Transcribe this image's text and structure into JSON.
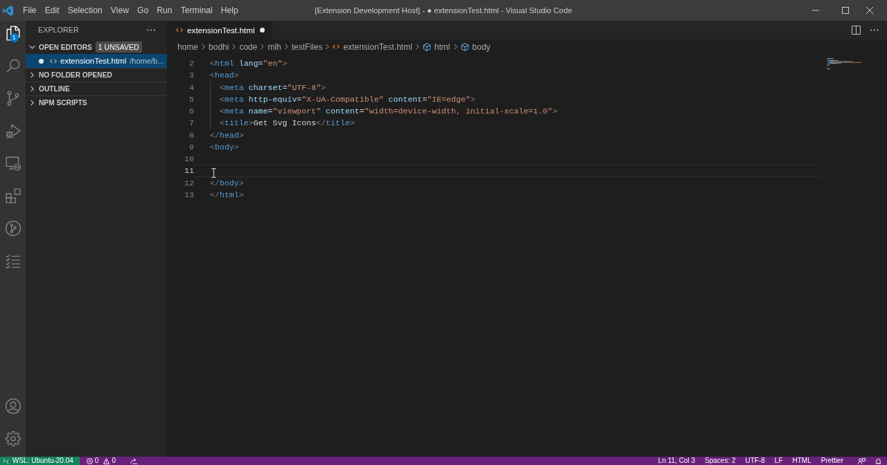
{
  "window": {
    "title": "[Extension Development Host] - ● extensionTest.html - Visual Studio Code"
  },
  "menu": [
    "File",
    "Edit",
    "Selection",
    "View",
    "Go",
    "Run",
    "Terminal",
    "Help"
  ],
  "activity_bar": {
    "top": [
      {
        "kind": "explorer",
        "selected": true,
        "badge": "1"
      },
      {
        "kind": "search",
        "selected": false
      },
      {
        "kind": "source_control",
        "selected": false
      },
      {
        "kind": "run_debug",
        "selected": false
      },
      {
        "kind": "remote_explorer",
        "selected": false
      },
      {
        "kind": "extensions",
        "selected": false
      },
      {
        "kind": "github",
        "selected": false
      },
      {
        "kind": "testing",
        "selected": false
      }
    ],
    "bottom": [
      {
        "kind": "accounts"
      },
      {
        "kind": "settings"
      }
    ]
  },
  "sidebar": {
    "title": "EXPLORER",
    "sections": [
      {
        "title": "OPEN EDITORS",
        "expanded": true,
        "badge": "1 UNSAVED",
        "items": [
          {
            "name": "extensionTest.html",
            "description": "/home/b…",
            "selected": true,
            "unsaved": true
          }
        ]
      },
      {
        "title": "NO FOLDER OPENED",
        "expanded": false
      },
      {
        "title": "OUTLINE",
        "expanded": false
      },
      {
        "title": "NPM SCRIPTS",
        "expanded": false
      }
    ]
  },
  "editor": {
    "tabs": [
      {
        "label": "extensionTest.html",
        "selected": true,
        "unsaved": true
      }
    ],
    "breadcrumbs": [
      {
        "kind": "folder",
        "label": "home"
      },
      {
        "kind": "folder",
        "label": "bodhi"
      },
      {
        "kind": "folder",
        "label": "code"
      },
      {
        "kind": "folder",
        "label": "mlh"
      },
      {
        "kind": "folder",
        "label": "testFiles"
      },
      {
        "kind": "file",
        "label": "extensionTest.html"
      },
      {
        "kind": "symbol",
        "label": "html"
      },
      {
        "kind": "symbol",
        "label": "body"
      }
    ],
    "lines": [
      {
        "number": "2",
        "indented": false,
        "current": false,
        "tokens": [
          {
            "kind": "punct",
            "text": "<"
          },
          {
            "kind": "tag",
            "text": "html"
          },
          {
            "kind": "attr",
            "text": " lang"
          },
          {
            "kind": "plain",
            "text": "="
          },
          {
            "kind": "string",
            "text": "\"en\""
          },
          {
            "kind": "punct",
            "text": ">"
          }
        ]
      },
      {
        "number": "3",
        "indented": false,
        "current": false,
        "tokens": [
          {
            "kind": "punct",
            "text": "<"
          },
          {
            "kind": "tag",
            "text": "head"
          },
          {
            "kind": "punct",
            "text": ">"
          }
        ]
      },
      {
        "number": "4",
        "indented": true,
        "current": false,
        "tokens": [
          {
            "kind": "punct",
            "text": "<"
          },
          {
            "kind": "tag",
            "text": "meta"
          },
          {
            "kind": "attr",
            "text": " charset"
          },
          {
            "kind": "plain",
            "text": "="
          },
          {
            "kind": "string",
            "text": "\"UTF-8\""
          },
          {
            "kind": "punct",
            "text": ">"
          }
        ]
      },
      {
        "number": "5",
        "indented": true,
        "current": false,
        "tokens": [
          {
            "kind": "punct",
            "text": "<"
          },
          {
            "kind": "tag",
            "text": "meta"
          },
          {
            "kind": "attr",
            "text": " http-equiv"
          },
          {
            "kind": "plain",
            "text": "="
          },
          {
            "kind": "string",
            "text": "\"X-UA-Compatible\""
          },
          {
            "kind": "attr",
            "text": " content"
          },
          {
            "kind": "plain",
            "text": "="
          },
          {
            "kind": "string",
            "text": "\"IE=edge\""
          },
          {
            "kind": "punct",
            "text": ">"
          }
        ]
      },
      {
        "number": "6",
        "indented": true,
        "current": false,
        "tokens": [
          {
            "kind": "punct",
            "text": "<"
          },
          {
            "kind": "tag",
            "text": "meta"
          },
          {
            "kind": "attr",
            "text": " name"
          },
          {
            "kind": "plain",
            "text": "="
          },
          {
            "kind": "string",
            "text": "\"viewport\""
          },
          {
            "kind": "attr",
            "text": " content"
          },
          {
            "kind": "plain",
            "text": "="
          },
          {
            "kind": "string",
            "text": "\"width=device-width, initial-scale=1.0\""
          },
          {
            "kind": "punct",
            "text": ">"
          }
        ]
      },
      {
        "number": "7",
        "indented": true,
        "current": false,
        "tokens": [
          {
            "kind": "punct",
            "text": "<"
          },
          {
            "kind": "tag",
            "text": "title"
          },
          {
            "kind": "punct",
            "text": ">"
          },
          {
            "kind": "plain",
            "text": "Get Svg Icons"
          },
          {
            "kind": "punct",
            "text": "</"
          },
          {
            "kind": "tag",
            "text": "title"
          },
          {
            "kind": "punct",
            "text": ">"
          }
        ]
      },
      {
        "number": "8",
        "indented": false,
        "current": false,
        "tokens": [
          {
            "kind": "punct",
            "text": "</"
          },
          {
            "kind": "tag",
            "text": "head"
          },
          {
            "kind": "punct",
            "text": ">"
          }
        ]
      },
      {
        "number": "9",
        "indented": false,
        "current": false,
        "tokens": [
          {
            "kind": "punct",
            "text": "<"
          },
          {
            "kind": "tag",
            "text": "body"
          },
          {
            "kind": "punct",
            "text": ">"
          }
        ]
      },
      {
        "number": "10",
        "indented": false,
        "current": false
      },
      {
        "number": "11",
        "indented": false,
        "current": true
      },
      {
        "number": "12",
        "indented": false,
        "current": false,
        "tokens": [
          {
            "kind": "punct",
            "text": "</"
          },
          {
            "kind": "tag",
            "text": "body"
          },
          {
            "kind": "punct",
            "text": ">"
          }
        ]
      },
      {
        "number": "13",
        "indented": false,
        "current": false,
        "tokens": [
          {
            "kind": "punct",
            "text": "</"
          },
          {
            "kind": "tag",
            "text": "html"
          },
          {
            "kind": "punct",
            "text": ">"
          }
        ]
      }
    ]
  },
  "status_bar": {
    "left": [
      {
        "kind": "remote",
        "label": "WSL: Ubuntu-20.04"
      },
      {
        "kind": "problems",
        "errors": "0",
        "warnings": "0"
      },
      {
        "kind": "live_share"
      }
    ],
    "right": [
      {
        "kind": "text",
        "label": "Ln 11, Col 3"
      },
      {
        "kind": "text",
        "label": "Spaces: 2"
      },
      {
        "kind": "text",
        "label": "UTF-8"
      },
      {
        "kind": "text",
        "label": "LF"
      },
      {
        "kind": "text",
        "label": "HTML"
      },
      {
        "kind": "text",
        "label": "Prettier"
      },
      {
        "kind": "feedback"
      },
      {
        "kind": "notifications"
      }
    ]
  }
}
